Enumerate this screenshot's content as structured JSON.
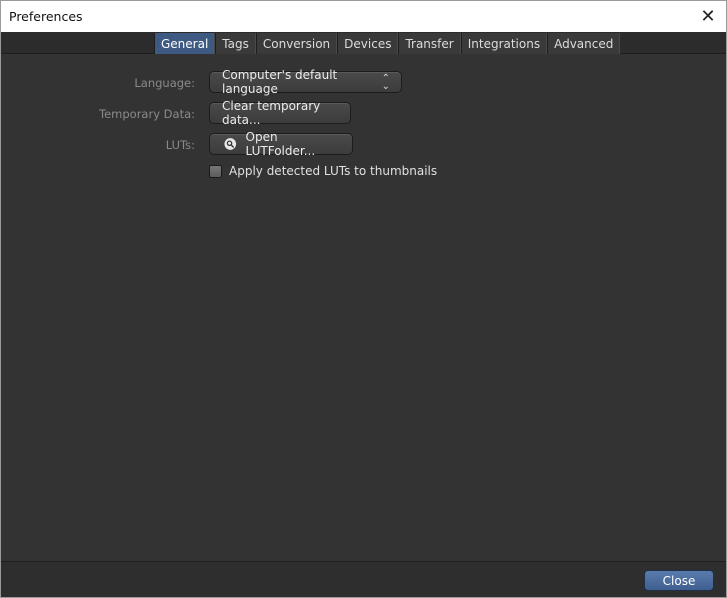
{
  "window": {
    "title": "Preferences"
  },
  "tabs": [
    {
      "label": "General",
      "active": true
    },
    {
      "label": "Tags",
      "active": false
    },
    {
      "label": "Conversion",
      "active": false
    },
    {
      "label": "Devices",
      "active": false
    },
    {
      "label": "Transfer",
      "active": false
    },
    {
      "label": "Integrations",
      "active": false
    },
    {
      "label": "Advanced",
      "active": false
    }
  ],
  "general": {
    "language_label": "Language:",
    "language_value": "Computer's default language",
    "temp_label": "Temporary Data:",
    "temp_button": "Clear temporary data...",
    "luts_label": "LUTs:",
    "luts_button": "Open LUTFolder...",
    "apply_luts_label": "Apply detected LUTs to thumbnails",
    "apply_luts_checked": false
  },
  "footer": {
    "close_label": "Close"
  },
  "icons": {
    "window_close": "close-icon",
    "language_chevron": "chevron-up-down-icon",
    "luts_button_icon": "search-icon"
  },
  "colors": {
    "background": "#333333",
    "active_tab": "#3e5a82",
    "primary_button": "#4a6ca0"
  }
}
